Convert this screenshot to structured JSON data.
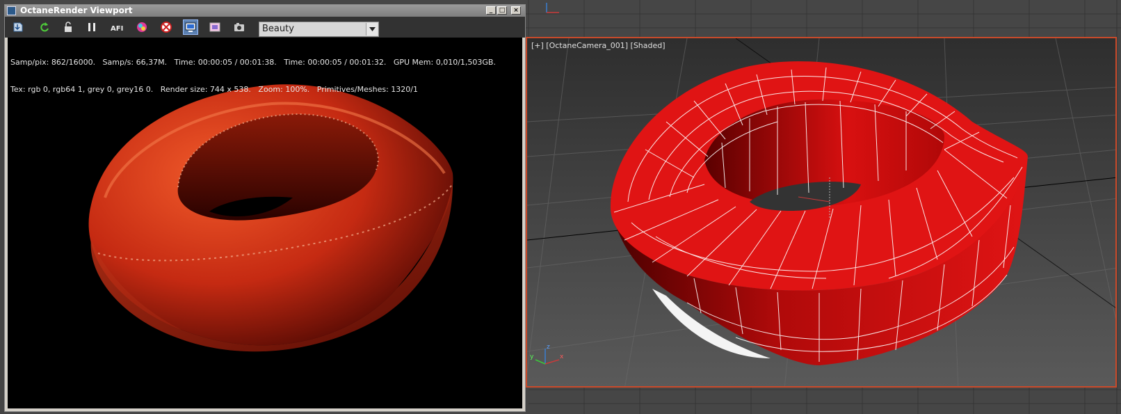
{
  "window": {
    "title": "OctaneRender Viewport",
    "controls": {
      "minimize": "_",
      "maximize": "□",
      "close": "×"
    }
  },
  "toolbar": {
    "buttons": [
      {
        "icon": "save-render-icon"
      },
      {
        "icon": "restart-render-icon"
      },
      {
        "icon": "lock-icon"
      },
      {
        "icon": "pause-icon"
      },
      {
        "icon": "afi-icon",
        "label": "AFI"
      },
      {
        "icon": "color-picker-icon"
      },
      {
        "icon": "focus-target-icon"
      },
      {
        "icon": "viewport-display-icon"
      },
      {
        "icon": "region-render-icon"
      },
      {
        "icon": "camera-icon"
      }
    ],
    "render_pass": "Beauty"
  },
  "stats": {
    "line1": "Samp/pix: 862/16000.   Samp/s: 66,37M.   Time: 00:00:05 / 00:01:38.   Time: 00:00:05 / 00:01:32.   GPU Mem: 0,010/1,503GB.",
    "line2": "Tex: rgb 0, rgb64 1, grey 0, grey16 0.   Render size: 744 x 538.   Zoom: 100%.   Primitives/Meshes: 1320/1"
  },
  "viewport": {
    "label": "[+] [OctaneCamera_001] [Shaded]",
    "axes": {
      "x": "x",
      "y": "y",
      "z": "z"
    }
  },
  "colors": {
    "object_red": "#e01414",
    "render_red": "#c52a12",
    "viewport_border": "#c94a2a"
  }
}
